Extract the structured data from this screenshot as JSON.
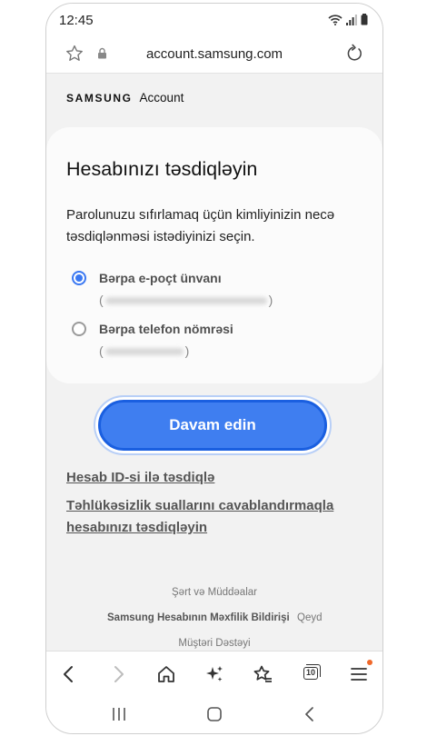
{
  "status_bar": {
    "time": "12:45"
  },
  "browser": {
    "url": "account.samsung.com"
  },
  "brand": {
    "samsung": "SAMSUNG",
    "account": "Account"
  },
  "card": {
    "title": "Hesabınızı təsdiqləyin",
    "description": "Parolunuzu sıfırlamaq üçün kimliyinizin necə təsdiqlənməsi istədiyinizi seçin.",
    "options": [
      {
        "label": "Bərpa e-poçt ünvanı",
        "selected": true
      },
      {
        "label": "Bərpa telefon nömrəsi",
        "selected": false
      }
    ]
  },
  "continue_button": {
    "label": "Davam edin"
  },
  "links": {
    "verify_by_id": "Hesab ID-si ilə təsdiqlə",
    "security_questions": "Təhlükəsizlik suallarını cavablandırmaqla hesabınızı təsdiqləyin"
  },
  "footer": {
    "terms": "Şərt və Müddəalar",
    "privacy": "Samsung Hesabının Məxfilik Bildirişi",
    "register": "Qeyd",
    "support": "Müştəri Dəstəyi"
  },
  "toolbar": {
    "tabs_count": "10"
  },
  "colors": {
    "accent": "#3f7ef0",
    "radio_selected": "#3a78f2",
    "notification_dot": "#f0682a"
  },
  "icons": {
    "browser": [
      "star-icon",
      "lock-icon",
      "reload-icon"
    ],
    "toolbar": [
      "back-icon",
      "forward-icon",
      "home-icon",
      "sparkle-icon",
      "bookmarks-icon",
      "tabs-icon",
      "menu-icon"
    ],
    "navigation": [
      "recent-apps-icon",
      "home-nav-icon",
      "back-nav-icon"
    ]
  }
}
